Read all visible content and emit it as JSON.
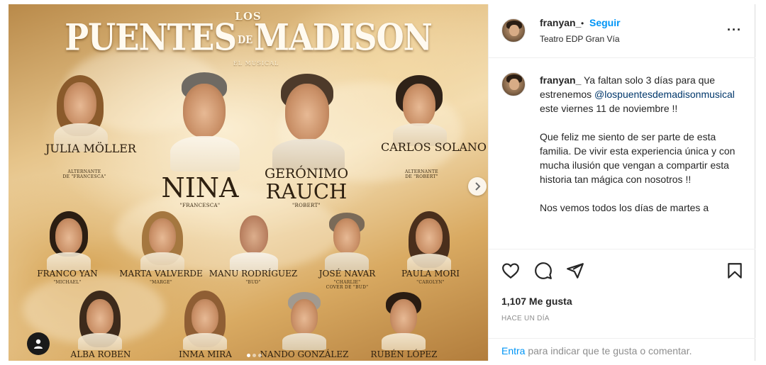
{
  "poster": {
    "logo_los": "LOS",
    "logo_title_1": "PUENTES",
    "logo_de": "DE",
    "logo_title_2": "MADISON",
    "logo_sub": "EL MUSICAL",
    "cast": [
      {
        "name": "JULIA MÖLLER",
        "role_1": "ALTERNANTE",
        "role_2": "DE \"FRANCESCA\""
      },
      {
        "name": "NINA",
        "role_1": "\"FRANCESCA\""
      },
      {
        "name_1": "GERÓNIMO",
        "name_2": "RAUCH",
        "role_1": "\"ROBERT\""
      },
      {
        "name": "CARLOS SOLANO",
        "role_1": "ALTERNANTE",
        "role_2": "DE \"ROBERT\""
      },
      {
        "name": "FRANCO YAN",
        "role_1": "\"MICHAEL\""
      },
      {
        "name": "MARTA VALVERDE",
        "role_1": "\"MARGE\""
      },
      {
        "name": "MANU RODRÍGUEZ",
        "role_1": "\"BUD\""
      },
      {
        "name": "JOSÉ NAVAR",
        "role_1": "\"CHARLIE\"",
        "role_2": "COVER DE \"BUD\""
      },
      {
        "name": "PAULA MORI",
        "role_1": "\"CAROLYN\""
      },
      {
        "name": "ALBA ROBEN"
      },
      {
        "name": "INMA MIRA"
      },
      {
        "name": "NANDO GONZÁLEZ"
      },
      {
        "name": "RUBÉN LÓPEZ"
      }
    ],
    "carousel_next_icon": "chevron-right-icon",
    "carousel_pages": 3,
    "carousel_active": 1,
    "tag_icon": "user-icon"
  },
  "post": {
    "username": "franyan_",
    "separator": "•",
    "follow_label": "Seguir",
    "location": "Teatro EDP Gran Vía",
    "more_icon": "more-horizontal-icon",
    "more_label": "···",
    "caption": {
      "username": "franyan_",
      "line1_text": " Ya faltan solo 3 días para que estrenemos ",
      "mention": "@lospuentesdemadisonmusical",
      "line1_end": " este viernes 11 de noviembre !!",
      "paragraph2": "Que feliz me siento de ser parte de esta familia. De vivir esta experiencia única y con mucha ilusión que vengan a compartir esta historia tan mágica con nosotros !!",
      "paragraph3": "Nos vemos todos los días de martes a"
    },
    "icons": [
      "heart-icon",
      "comment-icon",
      "share-icon",
      "bookmark-icon"
    ],
    "likes": "1,107 Me gusta",
    "time": "HACE UN DÍA",
    "comment_lead": "Entra",
    "comment_rest": " para indicar que te gusta o comentar."
  }
}
